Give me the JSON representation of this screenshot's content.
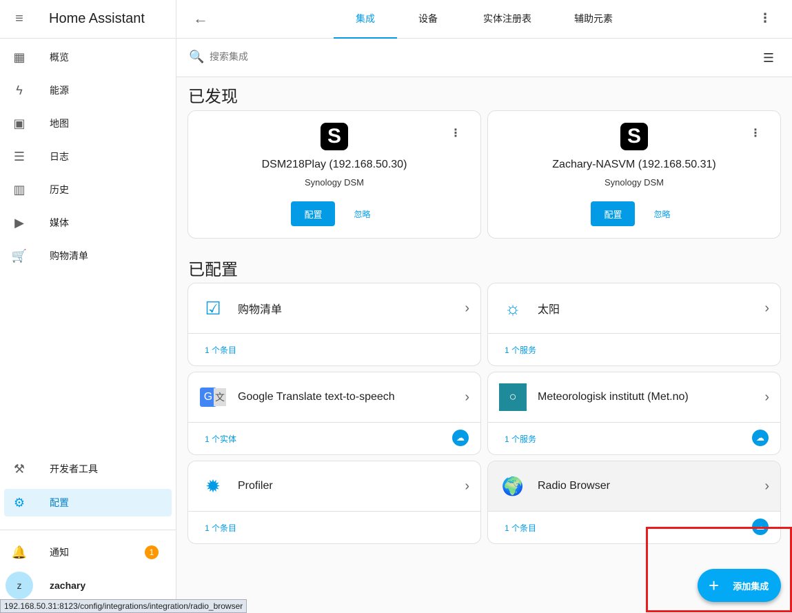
{
  "sidebar": {
    "title": "Home Assistant",
    "items": [
      {
        "label": "概览",
        "icon": "dashboard-icon"
      },
      {
        "label": "能源",
        "icon": "lightning-icon"
      },
      {
        "label": "地图",
        "icon": "map-icon"
      },
      {
        "label": "日志",
        "icon": "list-icon"
      },
      {
        "label": "历史",
        "icon": "chart-icon"
      },
      {
        "label": "媒体",
        "icon": "media-icon"
      },
      {
        "label": "购物清单",
        "icon": "cart-icon"
      }
    ],
    "dev_tools": "开发者工具",
    "config": "配置",
    "notifications": "通知",
    "notification_count": "1",
    "user": "zachary",
    "avatar_letter": "z"
  },
  "header": {
    "tabs": [
      "集成",
      "设备",
      "实体注册表",
      "辅助元素"
    ]
  },
  "search": {
    "placeholder": "搜索集成"
  },
  "discovered": {
    "heading": "已发现",
    "items": [
      {
        "name": "DSM218Play (192.168.50.30)",
        "sub": "Synology DSM",
        "configure": "配置",
        "ignore": "忽略"
      },
      {
        "name": "Zachary-NASVM (192.168.50.31)",
        "sub": "Synology DSM",
        "configure": "配置",
        "ignore": "忽略"
      }
    ]
  },
  "configured": {
    "heading": "已配置",
    "items": [
      {
        "name": "购物清单",
        "count": "1 个条目"
      },
      {
        "name": "太阳",
        "count": "1 个服务"
      },
      {
        "name": "Google Translate text-to-speech",
        "count": "1 个实体"
      },
      {
        "name": "Meteorologisk institutt (Met.no)",
        "count": "1 个服务"
      },
      {
        "name": "Profiler",
        "count": "1 个条目"
      },
      {
        "name": "Radio Browser",
        "count": "1 个条目"
      }
    ]
  },
  "fab": {
    "label": "添加集成"
  },
  "status_url": "192.168.50.31:8123/config/integrations/integration/radio_browser"
}
